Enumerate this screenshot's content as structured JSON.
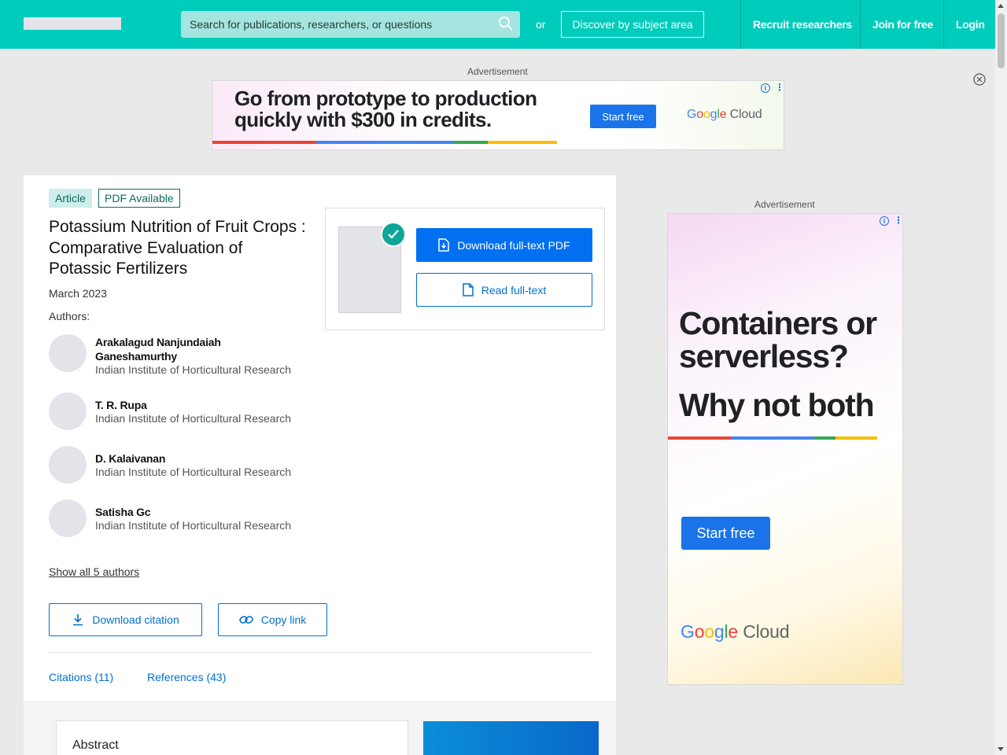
{
  "header": {
    "search_placeholder": "Search for publications, researchers, or questions",
    "or_text": "or",
    "discover_label": "Discover by subject area",
    "recruit_label": "Recruit researchers",
    "join_label": "Join for free",
    "login_label": "Login"
  },
  "ads": {
    "label": "Advertisement",
    "top": {
      "headline": "Go from prototype to production quickly with $300 in credits.",
      "cta": "Start free",
      "brand": [
        "G",
        "o",
        "o",
        "g",
        "l",
        "e"
      ],
      "brand_suffix": "Cloud"
    },
    "side": {
      "headline1": "Containers or serverless?",
      "headline2": "Why not both",
      "cta": "Start free",
      "brand": [
        "G",
        "o",
        "o",
        "g",
        "l",
        "e"
      ],
      "brand_suffix": "Cloud"
    },
    "stripe_colors": [
      "#ea4335",
      "#4285f4",
      "#34a853",
      "#fbbc05"
    ]
  },
  "publication": {
    "type_tag": "Article",
    "availability_tag": "PDF Available",
    "title": "Potassium Nutrition of Fruit Crops : Comparative Evaluation of Potassic Fertilizers",
    "date": "March 2023",
    "authors_label": "Authors:",
    "authors": [
      {
        "name": "Arakalagud Nanjundaiah Ganeshamurthy",
        "affiliation": "Indian Institute of Horticultural Research"
      },
      {
        "name": "T. R. Rupa",
        "affiliation": "Indian Institute of Horticultural Research"
      },
      {
        "name": "D. Kalaivanan",
        "affiliation": "Indian Institute of Horticultural Research"
      },
      {
        "name": "Satisha Gc",
        "affiliation": "Indian Institute of Horticultural Research"
      }
    ],
    "show_all_authors": "Show all 5 authors",
    "download_citation": "Download citation",
    "copy_link": "Copy link",
    "tabs": [
      "Citations (11)",
      "References (43)"
    ],
    "abstract_title": "Abstract"
  },
  "pdf_panel": {
    "download_label": "Download full-text PDF",
    "read_label": "Read full-text"
  },
  "colors": {
    "brand": "#00ccbb",
    "primary": "#0070f0",
    "tag_bg": "#cdeeea"
  }
}
